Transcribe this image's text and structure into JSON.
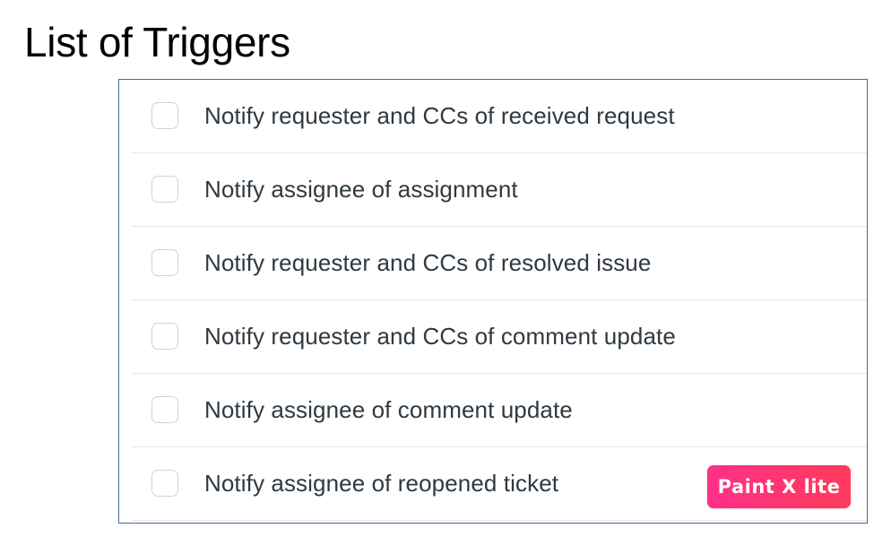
{
  "page": {
    "title": "List of Triggers"
  },
  "triggers": {
    "items": [
      {
        "label": "Notify requester and CCs of received request",
        "checked": false
      },
      {
        "label": "Notify assignee of assignment",
        "checked": false
      },
      {
        "label": "Notify requester and CCs of resolved issue",
        "checked": false
      },
      {
        "label": "Notify requester and CCs of comment update",
        "checked": false
      },
      {
        "label": "Notify assignee of comment update",
        "checked": false
      },
      {
        "label": "Notify assignee of reopened ticket",
        "checked": false
      }
    ]
  },
  "watermark": {
    "text": "Paint X lite"
  },
  "colors": {
    "panel_border": "#4a6894",
    "row_divider": "#e6e7ea",
    "label_text": "#2f3941",
    "badge_start": "#ff2f87",
    "badge_end": "#ff3b5c"
  }
}
